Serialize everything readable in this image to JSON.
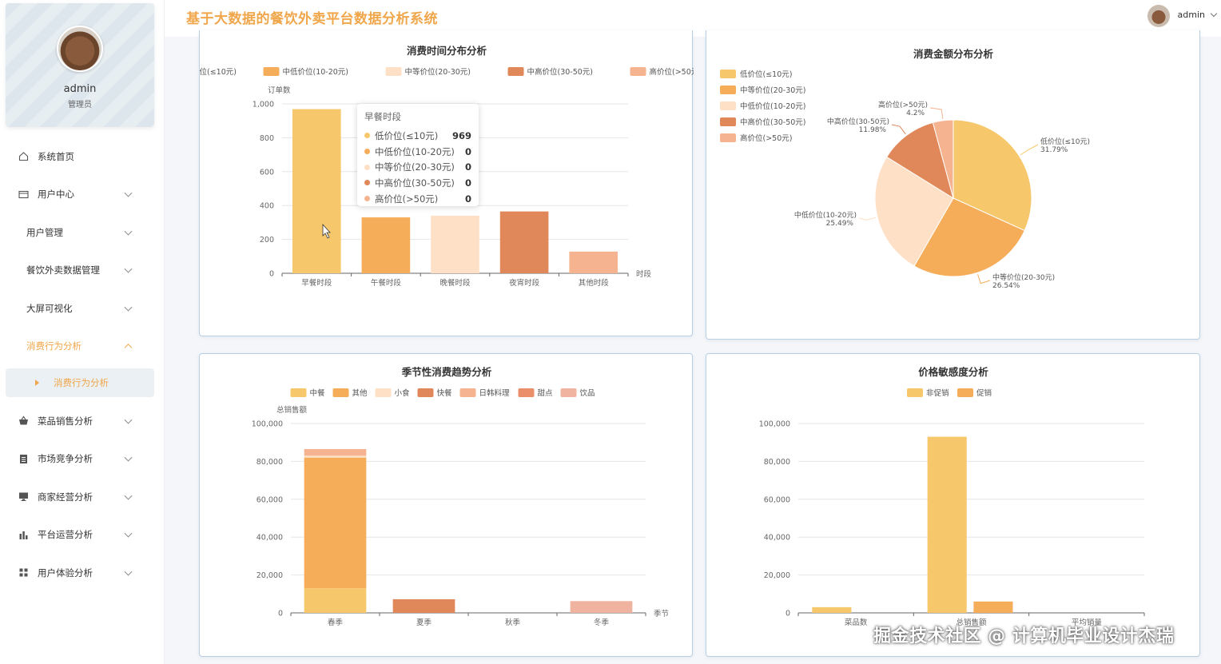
{
  "header": {
    "title": "基于大数据的餐饮外卖平台数据分析系统",
    "username": "admin"
  },
  "profile": {
    "name": "admin",
    "role": "管理员"
  },
  "menu": [
    {
      "label": "系统首页",
      "icon": "home-icon"
    },
    {
      "label": "用户中心",
      "icon": "card-icon"
    },
    {
      "label": "用户管理"
    },
    {
      "label": "餐饮外卖数据管理"
    },
    {
      "label": "大屏可视化"
    },
    {
      "label": "消费行为分析"
    },
    {
      "label": "消费行为分析"
    },
    {
      "label": "菜品销售分析",
      "icon": "basket-icon"
    },
    {
      "label": "市场竞争分析",
      "icon": "document-icon"
    },
    {
      "label": "商家经营分析",
      "icon": "monitor-icon"
    },
    {
      "label": "平台运营分析",
      "icon": "bar-chart-icon"
    },
    {
      "label": "用户体验分析",
      "icon": "grid-icon"
    }
  ],
  "colors": {
    "c1": "#f7c86b",
    "c2": "#f5ad5a",
    "c3": "#fde0c5",
    "c4": "#e0885a",
    "c5": "#f5b48f",
    "c6": "#ea8f6a",
    "c7": "#f0b3a0",
    "accent": "#f0a64a"
  },
  "tooltip": {
    "title": "早餐时段",
    "rows": [
      {
        "label": "低价位(≤10元)",
        "value": "969"
      },
      {
        "label": "中低价位(10-20元)",
        "value": "0"
      },
      {
        "label": "中等价位(20-30元)",
        "value": "0"
      },
      {
        "label": "中高价位(30-50元)",
        "value": "0"
      },
      {
        "label": "高价位(>50元)",
        "value": "0"
      }
    ]
  },
  "watermark": "掘金技术社区 @ 计算机毕业设计杰瑞",
  "chart_data": [
    {
      "type": "bar",
      "title": "消费时间分布分析",
      "ylabel": "订单数",
      "xlabel": "时段",
      "categories": [
        "早餐时段",
        "午餐时段",
        "晚餐时段",
        "夜宵时段",
        "其他时段"
      ],
      "ylim": [
        0,
        1000
      ],
      "yticks": [
        "0",
        "200",
        "400",
        "600",
        "800",
        "1,000"
      ],
      "legend": "top",
      "series": [
        {
          "name": "低价位(≤10元)",
          "values": [
            969,
            0,
            0,
            0,
            0
          ]
        },
        {
          "name": "中低价位(10-20元)",
          "values": [
            0,
            330,
            0,
            0,
            0
          ]
        },
        {
          "name": "中等价位(20-30元)",
          "values": [
            0,
            0,
            340,
            0,
            0
          ]
        },
        {
          "name": "中高价位(30-50元)",
          "values": [
            0,
            0,
            0,
            365,
            0
          ]
        },
        {
          "name": "高价位(>50元)",
          "values": [
            0,
            0,
            0,
            0,
            128
          ]
        }
      ]
    },
    {
      "type": "pie",
      "title": "消费金额分布分析",
      "legend": "left",
      "slices": [
        {
          "name": "低价位(≤10元)",
          "value": 31.79,
          "label": "31.79%"
        },
        {
          "name": "中等价位(20-30元)",
          "value": 26.54,
          "label": "26.54%"
        },
        {
          "name": "中低价位(10-20元)",
          "value": 25.49,
          "label": "25.49%"
        },
        {
          "name": "中高价位(30-50元)",
          "value": 11.98,
          "label": "11.98%"
        },
        {
          "name": "高价位(>50元)",
          "value": 4.2,
          "label": "4.2%"
        }
      ],
      "legend_items": [
        "低价位(≤10元)",
        "中等价位(20-30元)",
        "中低价位(10-20元)",
        "中高价位(30-50元)",
        "高价位(>50元)"
      ]
    },
    {
      "type": "bar",
      "title": "季节性消费趋势分析",
      "ylabel": "总销售额",
      "xlabel": "季节",
      "categories": [
        "春季",
        "夏季",
        "秋季",
        "冬季"
      ],
      "ylim": [
        0,
        100000
      ],
      "yticks": [
        "0",
        "20,000",
        "40,000",
        "60,000",
        "80,000",
        "100,000"
      ],
      "legend": "top",
      "stacked": true,
      "series": [
        {
          "name": "中餐",
          "values": [
            13000,
            0,
            0,
            0
          ]
        },
        {
          "name": "其他",
          "values": [
            69000,
            0,
            0,
            0
          ]
        },
        {
          "name": "小食",
          "values": [
            1000,
            0,
            0,
            0
          ]
        },
        {
          "name": "快餐",
          "values": [
            0,
            7200,
            0,
            0
          ]
        },
        {
          "name": "日韩料理",
          "values": [
            3500,
            0,
            0,
            0
          ]
        },
        {
          "name": "甜点",
          "values": [
            0,
            0,
            0,
            0
          ]
        },
        {
          "name": "饮品",
          "values": [
            0,
            0,
            0,
            6200
          ]
        }
      ]
    },
    {
      "type": "bar",
      "title": "价格敏感度分析",
      "categories": [
        "菜品数",
        "总销售额",
        "平均销量"
      ],
      "ylim": [
        0,
        100000
      ],
      "yticks": [
        "0",
        "20,000",
        "40,000",
        "60,000",
        "80,000",
        "100,000"
      ],
      "legend": "top",
      "series": [
        {
          "name": "非促销",
          "values": [
            3000,
            93000,
            0
          ]
        },
        {
          "name": "促销",
          "values": [
            0,
            6000,
            0
          ]
        }
      ]
    }
  ]
}
